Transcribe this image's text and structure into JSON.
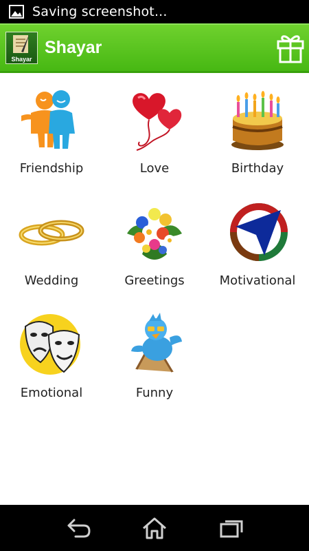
{
  "status_bar": {
    "text": "Saving screenshot..."
  },
  "action_bar": {
    "title": "Shayar",
    "logo_label": "Shayar"
  },
  "categories": [
    {
      "label": "Friendship",
      "icon": "friendship-icon"
    },
    {
      "label": "Love",
      "icon": "heart-balloons-icon"
    },
    {
      "label": "Birthday",
      "icon": "birthday-cake-icon"
    },
    {
      "label": "Wedding",
      "icon": "wedding-rings-icon"
    },
    {
      "label": "Greetings",
      "icon": "flower-bouquet-icon"
    },
    {
      "label": "Motivational",
      "icon": "compass-arrow-icon"
    },
    {
      "label": "Emotional",
      "icon": "drama-masks-icon"
    },
    {
      "label": "Funny",
      "icon": "funny-bird-icon"
    }
  ],
  "colors": {
    "action_bar": "#4dbb16",
    "status_bar": "#000000",
    "nav_bar": "#000000"
  }
}
